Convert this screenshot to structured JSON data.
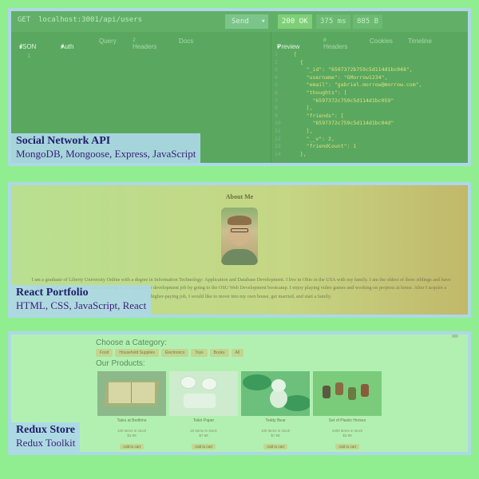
{
  "cards": [
    {
      "title": "Social Network API",
      "subtitle": "MongoDB, Mongoose, Express, JavaScript",
      "shot": {
        "method": "GET",
        "url": "localhost:3001/api/users",
        "send": "Send",
        "status": "200 OK",
        "time": "375 ms",
        "size": "885 B",
        "req_tabs": [
          "JSON",
          "Auth",
          "Query",
          "Headers",
          "Docs"
        ],
        "headers_count": "2",
        "res_tabs": [
          "Preview",
          "Headers",
          "Cookies",
          "Timeline"
        ],
        "res_headers_count": "8",
        "req_line": "1",
        "json_lines": [
          {
            "n": "1",
            "t": "["
          },
          {
            "n": "2",
            "t": "  {"
          },
          {
            "n": "3",
            "t": "    \"_id\": \"6597372b759c5d114d1bc048\","
          },
          {
            "n": "4",
            "t": "    \"username\": \"GMorrow1234\","
          },
          {
            "n": "5",
            "t": "    \"email\": \"gabriel.morrow@morrow.com\","
          },
          {
            "n": "6",
            "t": "    \"thoughts\": ["
          },
          {
            "n": "7",
            "t": "      \"6597372c759c5d114d1bc059\""
          },
          {
            "n": "8",
            "t": "    ],"
          },
          {
            "n": "9",
            "t": "    \"friends\": ["
          },
          {
            "n": "10",
            "t": "      \"6597372c759c5d114d1bc04d\""
          },
          {
            "n": "11",
            "t": "    ],"
          },
          {
            "n": "12",
            "t": "    \"__v\": 2,"
          },
          {
            "n": "13",
            "t": "    \"friendCount\": 1"
          },
          {
            "n": "14",
            "t": "  },"
          }
        ]
      }
    },
    {
      "title": "React Portfolio",
      "subtitle": "HTML, CSS, JavaScript, React",
      "shot": {
        "heading": "About Me",
        "bio": "I am a graduate of Liberty University Online with a degree in Information Technology: Application and Database Development. I live in Ohio in the USA with my family. I am the oldest of three siblings and have one brother and one sister. I am preparing to get a software development job by going to the OSU Web Development bootcamp. I enjoy playing video games and working on projects at home. After I acquire a higher-paying job, I would like to move into my own house, get married, and start a family."
      }
    },
    {
      "title": "Redux Store",
      "subtitle": "Redux Toolkit",
      "shot": {
        "category_heading": "Choose a Category:",
        "categories": [
          "Food",
          "Household Supplies",
          "Electronics",
          "Toys",
          "Books",
          "All"
        ],
        "products_heading": "Our Products:",
        "products": [
          {
            "name": "Tales at Bedtime",
            "stock": "100 items in stock",
            "price": "$3.99",
            "button": "Add to cart"
          },
          {
            "name": "Toilet Paper",
            "stock": "20 items in stock",
            "price": "$7.99",
            "button": "Add to cart"
          },
          {
            "name": "Teddy Bear",
            "stock": "100 items in stock",
            "price": "$7.99",
            "button": "Add to cart"
          },
          {
            "name": "Set of Plastic Horses",
            "stock": "1000 items in stock",
            "price": "$2.99",
            "button": "Add to cart"
          }
        ]
      }
    }
  ]
}
